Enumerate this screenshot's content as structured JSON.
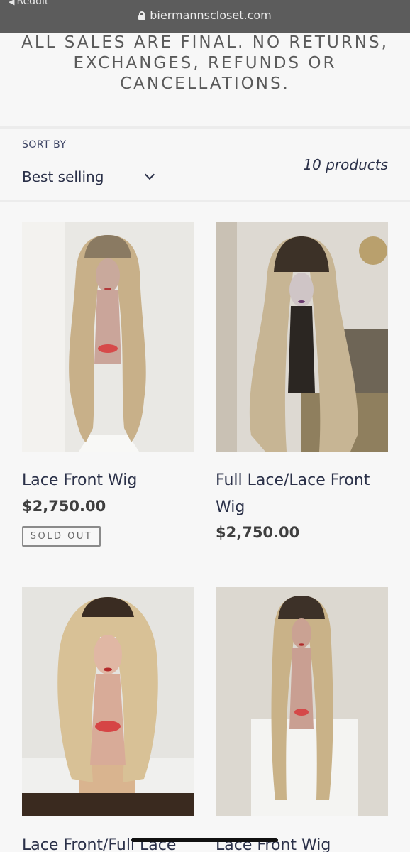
{
  "browser": {
    "back_label": "Reddit",
    "url": "biermannscloset.com"
  },
  "banner": {
    "text": "ALL SALES ARE FINAL. NO RETURNS, EXCHANGES, REFUNDS OR CANCELLATIONS."
  },
  "toolbar": {
    "sort_label": "SORT BY",
    "sort_value": "Best selling",
    "product_count": "10 products"
  },
  "products": [
    {
      "title": "Lace Front Wig",
      "price": "$2,750.00",
      "badge": "SOLD OUT"
    },
    {
      "title": "Full Lace/Lace Front Wig",
      "price": "$2,750.00"
    },
    {
      "title": "Lace Front/Full Lace"
    },
    {
      "title": "Lace Front Wig"
    }
  ],
  "colors": {
    "banner_text": "#5a5a5a",
    "link_text": "#2b3149",
    "browser_bar": "#5c5c5c"
  }
}
